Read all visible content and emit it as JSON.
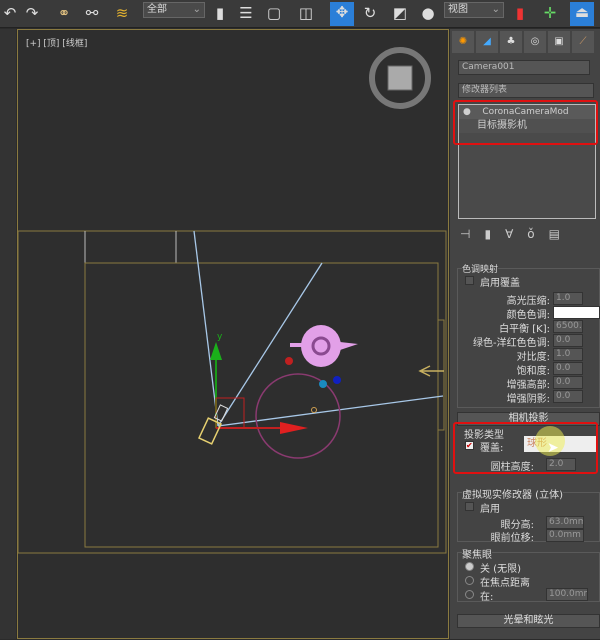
{
  "toolbar": {
    "selection_filter": "全部",
    "reference_coord": "视图",
    "icons": [
      "redo-icon",
      "link-icon",
      "unlink-icon",
      "bind-space-warp-icon",
      "select-object-icon",
      "select-by-name-icon",
      "rect-select-icon",
      "window-crossing-icon",
      "move-icon",
      "rotate-icon",
      "scale-icon",
      "pivot-icon",
      "mirror-icon",
      "align-icon"
    ]
  },
  "viewport": {
    "label": "[+] [顶] [线框]"
  },
  "panel": {
    "object_name": "Camera001",
    "modifier_list": "修改器列表",
    "stack": [
      "CoronaCameraMod",
      "目标摄影机"
    ],
    "tone_mapping": {
      "title": "色调映射",
      "override_label": "启用覆盖",
      "rows": [
        {
          "label": "高光压缩:",
          "value": "1.0"
        },
        {
          "label": "颜色色调:",
          "value": ""
        },
        {
          "label": "白平衡 [K]:",
          "value": "6500.0"
        },
        {
          "label": "绿色-洋红色色调:",
          "value": "0.0"
        },
        {
          "label": "对比度:",
          "value": "1.0"
        },
        {
          "label": "饱和度:",
          "value": "0.0"
        },
        {
          "label": "增强高部:",
          "value": "0.0"
        },
        {
          "label": "增强阴影:",
          "value": "0.0"
        }
      ]
    },
    "camera_projection": {
      "title": "相机投影",
      "type_label": "投影类型",
      "override_label": "覆盖:",
      "override_value": "球形",
      "cyl_label": "圆柱高度:",
      "cyl_value": "2.0"
    },
    "vr": {
      "title": "虚拟现实修改器 (立体)",
      "enable_label": "启用",
      "eye_sep_label": "眼分高:",
      "eye_sep_value": "63.0mm",
      "eye_offset_label": "眼前位移:",
      "eye_offset_value": "0.0mm"
    },
    "focus": {
      "title": "聚焦眼",
      "options": [
        "关 (无限)",
        "在焦点距离",
        "在:"
      ],
      "at_value": "100.0mm"
    },
    "bloom_glare": {
      "title": "光晕和眩光"
    }
  },
  "colors": {
    "highlight": "#e01010",
    "accent_blue": "#2b7fd8"
  }
}
